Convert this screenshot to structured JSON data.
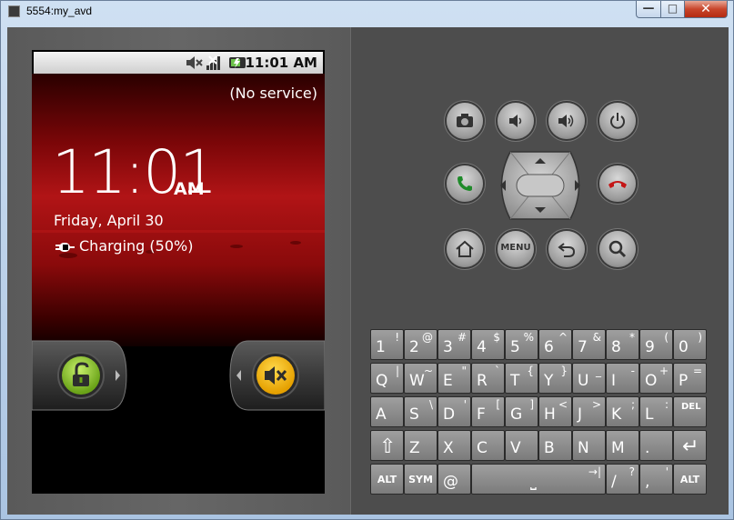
{
  "window": {
    "title": "5554:my_avd",
    "min": "—",
    "max": "□",
    "close": "✕"
  },
  "status_bar": {
    "time": "11:01 AM"
  },
  "lock": {
    "service": "(No service)",
    "time": "11:01",
    "ampm": "AM",
    "date": "Friday, April 30",
    "charging": "Charging (50%)"
  },
  "hw": {
    "menu": "MENU"
  },
  "keyboard": {
    "row1": [
      {
        "m": "1",
        "a": "!"
      },
      {
        "m": "2",
        "a": "@"
      },
      {
        "m": "3",
        "a": "#"
      },
      {
        "m": "4",
        "a": "$"
      },
      {
        "m": "5",
        "a": "%"
      },
      {
        "m": "6",
        "a": "^"
      },
      {
        "m": "7",
        "a": "&"
      },
      {
        "m": "8",
        "a": "*"
      },
      {
        "m": "9",
        "a": "("
      },
      {
        "m": "0",
        "a": ")"
      }
    ],
    "row2": [
      {
        "m": "Q",
        "a": "|"
      },
      {
        "m": "W",
        "a": "~"
      },
      {
        "m": "E",
        "a": "\""
      },
      {
        "m": "R",
        "a": "`"
      },
      {
        "m": "T",
        "a": "{"
      },
      {
        "m": "Y",
        "a": "}"
      },
      {
        "m": "U",
        "a": "_"
      },
      {
        "m": "I",
        "a": "-"
      },
      {
        "m": "O",
        "a": "+"
      },
      {
        "m": "P",
        "a": "="
      }
    ],
    "row3": [
      {
        "m": "A",
        "a": ""
      },
      {
        "m": "S",
        "a": "\\"
      },
      {
        "m": "D",
        "a": "'"
      },
      {
        "m": "F",
        "a": "["
      },
      {
        "m": "G",
        "a": "]"
      },
      {
        "m": "H",
        "a": "<"
      },
      {
        "m": "J",
        "a": ">"
      },
      {
        "m": "K",
        "a": ";"
      },
      {
        "m": "L",
        "a": ":"
      },
      {
        "m": "DEL",
        "a": ""
      }
    ],
    "row4": [
      {
        "m": "⇧",
        "a": ""
      },
      {
        "m": "Z",
        "a": ""
      },
      {
        "m": "X",
        "a": ""
      },
      {
        "m": "C",
        "a": ""
      },
      {
        "m": "V",
        "a": ""
      },
      {
        "m": "B",
        "a": ""
      },
      {
        "m": "N",
        "a": ""
      },
      {
        "m": "M",
        "a": ""
      },
      {
        "m": ".",
        "a": ""
      },
      {
        "m": "↵",
        "a": ""
      }
    ],
    "row5": {
      "alt_left": "ALT",
      "sym": "SYM",
      "at": "@",
      "space": "⎵",
      "tab": "→|",
      "slash": "/",
      "slash_alt": "?",
      "comma": ",",
      "comma_alt": "'",
      "alt_right": "ALT"
    }
  }
}
